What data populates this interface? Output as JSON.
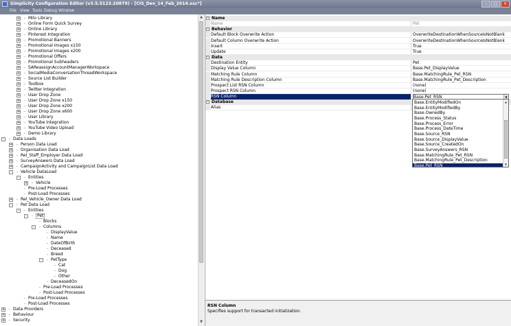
{
  "window": {
    "title": "Simplicity Configuration Editor (v3.5.5123.20879) - [CIS_Dev_14_Feb_2014.xsc*]",
    "controls": [
      "–",
      "□",
      "×"
    ]
  },
  "menu": {
    "items": [
      "File",
      "View",
      "Tools",
      "Debug",
      "Window"
    ]
  },
  "tree": {
    "rows": [
      {
        "level": 3,
        "exp": "+",
        "label": "Milo Library"
      },
      {
        "level": 3,
        "exp": "+",
        "label": "Online Form Quick Survey"
      },
      {
        "level": 3,
        "exp": "+",
        "label": "Online Library"
      },
      {
        "level": 3,
        "exp": "+",
        "label": "Pinterest Integration"
      },
      {
        "level": 3,
        "exp": "+",
        "label": "Promotional Banners"
      },
      {
        "level": 3,
        "exp": "+",
        "label": "Promotional Images x150"
      },
      {
        "level": 3,
        "exp": "+",
        "label": "Promotional Images x200"
      },
      {
        "level": 3,
        "exp": "+",
        "label": "Promotional Offers"
      },
      {
        "level": 3,
        "exp": "+",
        "label": "Promotional Subheaders"
      },
      {
        "level": 3,
        "exp": "+",
        "label": "SAReassignAccountManagerWorkspace"
      },
      {
        "level": 3,
        "exp": "+",
        "label": "SocialMediaConversationThreadWorkspace"
      },
      {
        "level": 3,
        "exp": "+",
        "label": "Source List Builder"
      },
      {
        "level": 3,
        "exp": "+",
        "label": "Toolbox"
      },
      {
        "level": 3,
        "exp": "+",
        "label": "Twitter Integration"
      },
      {
        "level": 3,
        "exp": "+",
        "label": "User Drop Zone"
      },
      {
        "level": 3,
        "exp": "+",
        "label": "User Drop Zone x150"
      },
      {
        "level": 3,
        "exp": "+",
        "label": "User Drop Zone x200"
      },
      {
        "level": 3,
        "exp": "+",
        "label": "User Drop Zone x600"
      },
      {
        "level": 3,
        "exp": "+",
        "label": "User Library"
      },
      {
        "level": 3,
        "exp": "+",
        "label": "YouTube Integration"
      },
      {
        "level": 3,
        "exp": "+",
        "label": "YouTube Video Upload"
      },
      {
        "level": 3,
        "exp": "+",
        "label": "Demo Library"
      },
      {
        "level": 1,
        "exp": "-",
        "label": "Data Loads"
      },
      {
        "level": 2,
        "exp": "+",
        "label": "Person Data Load"
      },
      {
        "level": 2,
        "exp": "+",
        "label": "Organisation Data Load"
      },
      {
        "level": 2,
        "exp": "+",
        "label": "Rel_Staff_Employer Data Load"
      },
      {
        "level": 2,
        "exp": "+",
        "label": "SurveyAnswers Data Load"
      },
      {
        "level": 2,
        "exp": "+",
        "label": "CampaignActivity and CampaignList Data Load"
      },
      {
        "level": 2,
        "exp": "-",
        "label": "Vehicle DataLoad"
      },
      {
        "level": 3,
        "exp": "-",
        "label": "Entities"
      },
      {
        "level": 4,
        "exp": "+",
        "label": "Vehicle"
      },
      {
        "level": 3,
        "exp": "",
        "label": "Pre-Load Processes"
      },
      {
        "level": 3,
        "exp": "",
        "label": "Post-Load Processes"
      },
      {
        "level": 2,
        "exp": "+",
        "label": "Rel_Vehicle_Owner Data Load"
      },
      {
        "level": 2,
        "exp": "-",
        "label": "Pet Data Load"
      },
      {
        "level": 3,
        "exp": "-",
        "label": "Entities"
      },
      {
        "level": 4,
        "exp": "-",
        "label": "Pet",
        "selected": true
      },
      {
        "level": 5,
        "exp": "",
        "label": "Blocks"
      },
      {
        "level": 5,
        "exp": "-",
        "label": "Columns"
      },
      {
        "level": 6,
        "exp": "",
        "label": "DisplayValue"
      },
      {
        "level": 6,
        "exp": "",
        "label": "Name"
      },
      {
        "level": 6,
        "exp": "",
        "label": "DateOfBirth"
      },
      {
        "level": 6,
        "exp": "",
        "label": "Deceased"
      },
      {
        "level": 6,
        "exp": "",
        "label": "Breed"
      },
      {
        "level": 6,
        "exp": "-",
        "label": "PetType"
      },
      {
        "level": 7,
        "exp": "",
        "label": "Cat"
      },
      {
        "level": 7,
        "exp": "",
        "label": "Dog"
      },
      {
        "level": 7,
        "exp": "",
        "label": "Other"
      },
      {
        "level": 6,
        "exp": "",
        "label": "DeceasedOn"
      },
      {
        "level": 5,
        "exp": "",
        "label": "Pre-Load Processes"
      },
      {
        "level": 5,
        "exp": "",
        "label": "Post-Load Processes"
      },
      {
        "level": 3,
        "exp": "",
        "label": "Pre-Load Processes"
      },
      {
        "level": 3,
        "exp": "",
        "label": "Post-Load Processes"
      },
      {
        "level": 1,
        "exp": "+",
        "label": "Data Providers"
      },
      {
        "level": 1,
        "exp": "+",
        "label": "Behaviour"
      },
      {
        "level": 1,
        "exp": "+",
        "label": "Security"
      }
    ]
  },
  "properties": {
    "rows": [
      {
        "kind": "cat",
        "name": "Name"
      },
      {
        "kind": "prop",
        "name": "Name",
        "value": "Pet",
        "dim": true
      },
      {
        "kind": "cat",
        "name": "Behavior"
      },
      {
        "kind": "prop",
        "name": "Default Block Overwrite Action",
        "value": "OverwriteDestinationWhenSourceIsNotBlank"
      },
      {
        "kind": "prop",
        "name": "Default Column Overwrite Action",
        "value": "OverwriteDestinationWhenSourceIsNotBlank"
      },
      {
        "kind": "prop",
        "name": "Insert",
        "value": "True"
      },
      {
        "kind": "prop",
        "name": "Update",
        "value": "True"
      },
      {
        "kind": "cat",
        "name": "Data"
      },
      {
        "kind": "prop",
        "name": "Destination Entity",
        "value": "Pet"
      },
      {
        "kind": "prop",
        "name": "Display Value Column",
        "value": "Base.Pet_DisplayValue"
      },
      {
        "kind": "prop",
        "name": "Matching Rule Column",
        "value": "Base.MatchingRule_Pet_RSN"
      },
      {
        "kind": "prop",
        "name": "Matching Rule Description Column",
        "value": "Base.MatchingRule_Pet_Description"
      },
      {
        "kind": "prop",
        "name": "Prospect List RSN Column",
        "value": "(none)"
      },
      {
        "kind": "prop",
        "name": "Prospect RSN Column",
        "value": "(none)"
      },
      {
        "kind": "prop",
        "name": "RSN Column",
        "value": "Base.Pet_RSN",
        "selected": true
      },
      {
        "kind": "cat",
        "name": "Database"
      },
      {
        "kind": "prop",
        "name": "Alias",
        "value": ""
      }
    ],
    "dropdown_options": [
      "Base.EntityModifiedOn",
      "Base.EntityModifiedBy",
      "Base.OwnedBy",
      "Base.Process_Status",
      "Base.Process_Error",
      "Base.Process_DateTime",
      "Base.Source_RSN",
      "Base.Source_DisplayValue",
      "Base.Source_CreatedOn",
      "Base.SurveyAnswers_RSN",
      "Base.MatchingRule_Pet_RSN",
      "Base.MatchingRule_Pet_Description",
      "Base.Pet_RSN"
    ],
    "dropdown_selected": "Base.Pet_RSN"
  },
  "help": {
    "title": "RSN Column",
    "description": "Specifies support for transacted initialization."
  }
}
